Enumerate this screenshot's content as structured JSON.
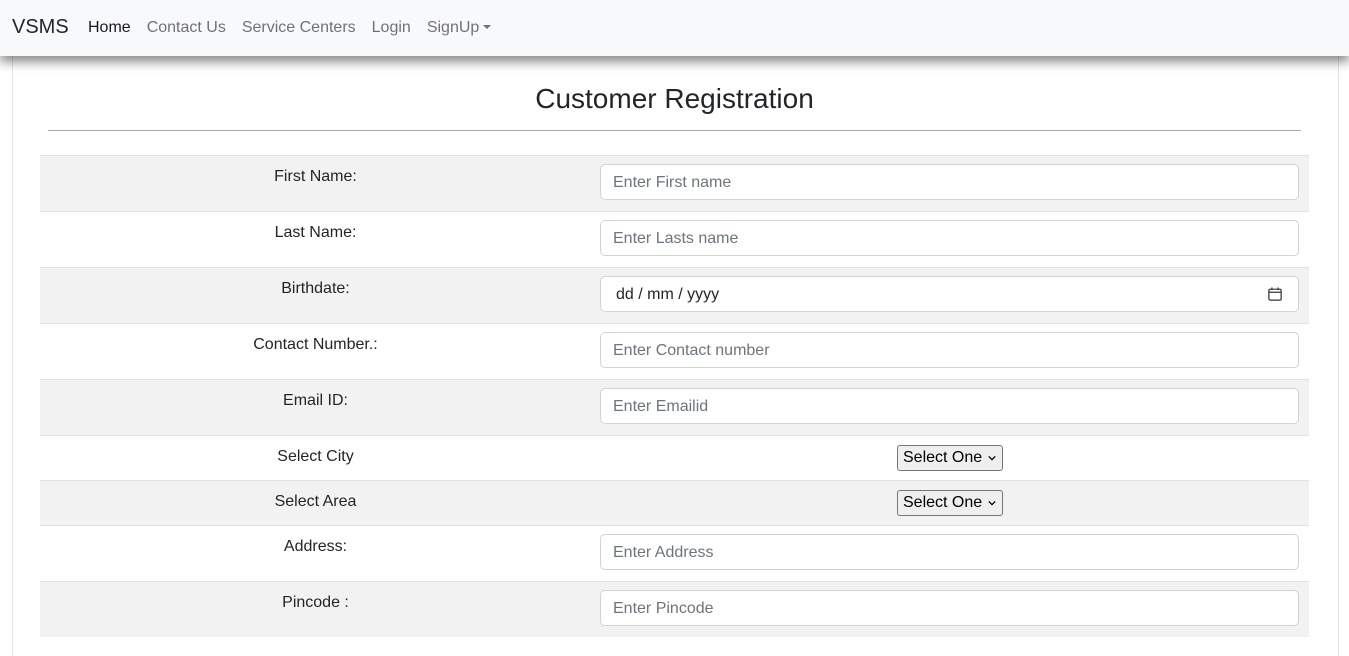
{
  "navbar": {
    "brand": "VSMS",
    "links": [
      "Home",
      "Contact Us",
      "Service Centers",
      "Login",
      "SignUp"
    ]
  },
  "form": {
    "title": "Customer Registration",
    "first_name": {
      "label": "First Name:",
      "placeholder": "Enter First name"
    },
    "last_name": {
      "label": "Last Name:",
      "placeholder": "Enter Lasts name"
    },
    "birthdate": {
      "label": "Birthdate:",
      "value": "dd / mm / yyyy"
    },
    "contact": {
      "label": "Contact Number.:",
      "placeholder": "Enter Contact number"
    },
    "email": {
      "label": "Email ID:",
      "placeholder": "Enter Emailid"
    },
    "city": {
      "label": "Select City",
      "selected": "Select One"
    },
    "area": {
      "label": "Select Area",
      "selected": "Select One"
    },
    "address": {
      "label": "Address:",
      "placeholder": "Enter Address"
    },
    "pincode": {
      "label": "Pincode :",
      "placeholder": "Enter Pincode"
    }
  },
  "icons": {
    "calendar": "calendar-icon",
    "dropdown_caret": "chevron-down-icon"
  },
  "colors": {
    "navbar_bg": "#f8f9fa",
    "striped_row": "#f2f2f2",
    "input_border": "#ced4da"
  }
}
